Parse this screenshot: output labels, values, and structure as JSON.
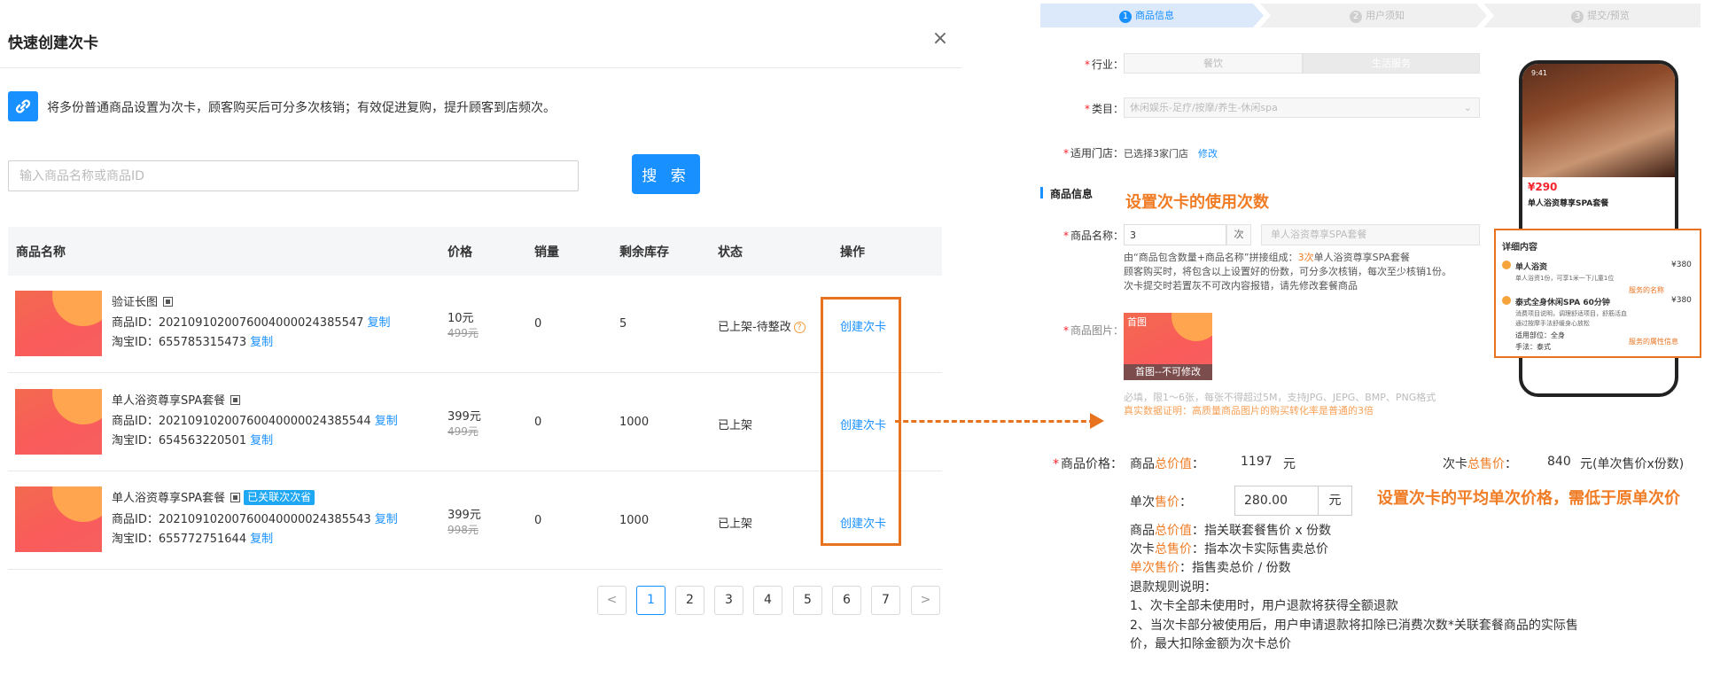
{
  "dialog": {
    "title": "快速创建次卡",
    "close": "×",
    "tip": "将多份普通商品设置为次卡，顾客购买后可分多次核销；有效促进复购，提升顾客到店频次。",
    "search_placeholder": "输入商品名称或商品ID",
    "search_button": "搜 索"
  },
  "table": {
    "headers": [
      "商品名称",
      "价格",
      "销量",
      "剩余库存",
      "状态",
      "操作"
    ],
    "rows": [
      {
        "name": "验证长图",
        "product_id": "商品ID：20210910200760040000243855​47",
        "taobao_id": "淘宝ID：655785315473",
        "price": "10元",
        "original_price": "499元",
        "sales": "0",
        "stock": "5",
        "status": "已上架-待整改",
        "action": "创建次卡"
      },
      {
        "name": "单人浴资尊享SPA套餐",
        "product_id": "商品ID：202109102007600400000243855​44",
        "taobao_id": "淘宝ID：654563220501",
        "price": "399元",
        "original_price": "499元",
        "sales": "0",
        "stock": "1000",
        "status": "已上架",
        "action": "创建次卡"
      },
      {
        "name": "单人浴资尊享SPA套餐",
        "tag": "已关联次次省",
        "product_id": "商品ID：202109102007600400000243855​43",
        "taobao_id": "淘宝ID：655772751644",
        "price": "399元",
        "original_price": "998元",
        "sales": "0",
        "stock": "1000",
        "status": "已上架",
        "action": "创建次卡"
      }
    ],
    "copy_label": "复制"
  },
  "pagination": {
    "prev": "<",
    "pages": [
      "1",
      "2",
      "3",
      "4",
      "5",
      "6",
      "7"
    ],
    "next": ">",
    "current": "1"
  },
  "steps": [
    {
      "num": "1",
      "label": "商品信息"
    },
    {
      "num": "2",
      "label": "用户须知"
    },
    {
      "num": "3",
      "label": "提交/预览"
    }
  ],
  "form": {
    "industry_label": "行业：",
    "industry_options": [
      "餐饮",
      "生活服务"
    ],
    "category_label": "类目：",
    "category_value": "休闲娱乐-足疗/按摩/养生-休闲spa",
    "store_label": "适用门店：",
    "store_value": "已选择3家门店",
    "store_edit": "修改",
    "section_title": "商品信息",
    "annotation_count": "设置次卡的使用次数",
    "name_label": "商品名称：",
    "count_value": "3",
    "count_unit": "次",
    "name_placeholder": "单人浴资尊享SPA套餐",
    "name_hint_1a": "由“商品包含数量+商品名称”拼接组成：",
    "name_hint_1b": "3次",
    "name_hint_1c": "单人浴资尊享SPA套餐",
    "name_hint_2": "顾客购买时，将包含以上设置好的份数，可分多次核销，每次至少核销1份。",
    "name_hint_3": "次卡提交时若置灰不可改内容报错，请先修改套餐商品",
    "image_label": "商品图片：",
    "image_tag": "首图",
    "image_caption": "首图--不可修改",
    "image_hint": "必填，限1～6张，每张不得超过5M，支持JPG、JEPG、BMP、PNG格式",
    "image_proof": "真实数据证明：高质量商品图片的购买转化率是普通的3倍",
    "price_label": "商品价格：",
    "total_label_a": "商品",
    "total_label_b": "总价值",
    "total_label_c": "：",
    "total_value": "1197",
    "total_unit": "元",
    "card_label_a": "次卡",
    "card_label_b": "总售价",
    "card_label_c": "：",
    "card_value": "840",
    "card_unit": "元(单次售价x份数)",
    "single_label_a": "单次",
    "single_label_b": "售价",
    "single_label_c": "：",
    "single_value": "280.00",
    "single_unit": "元",
    "annotation_price": "设置次卡的平均单次价格，需低于原单次价",
    "exp1_a": "商品",
    "exp1_b": "总价值",
    "exp1_c": "：指关联套餐售价 x 份数",
    "exp2_a": "次卡",
    "exp2_b": "总售价",
    "exp2_c": "：指本次卡实际售卖总价",
    "exp3_a": "单次售价",
    "exp3_c": "：指售卖总价 / 份数",
    "refund_title": "退款规则说明：",
    "refund_1": "1、次卡全部未使用时，用户退款将获得全额退款",
    "refund_2": "2、当次卡部分被使用后，用户申请退款将扣除已消费次数*关联套餐商品的实际售",
    "refund_3": "价，最大扣除金额为次卡总价"
  },
  "phone": {
    "time": "9:41",
    "price": "¥290",
    "title": "单人浴资尊享SPA套餐",
    "detail_title": "详细内容",
    "item1": "单人浴资",
    "item1_price": "¥380",
    "item1_desc": "单人浴资1份，可享1米一下儿童1位",
    "item1_note": "服务的名称",
    "item2": "泰式全身休闲SPA 60分钟",
    "item2_price": "¥380",
    "item2_desc_1": "消费项目说明，调理舒适项目，舒筋活血",
    "item2_desc_2": "通过按摩手法舒缓身心放松",
    "item2_attr_1": "适用部位：全身",
    "item2_attr_2": "手法：泰式",
    "item2_note": "服务的属性信息"
  },
  "colors": {
    "primary": "#1890ff",
    "annotation": "#e8731f"
  }
}
